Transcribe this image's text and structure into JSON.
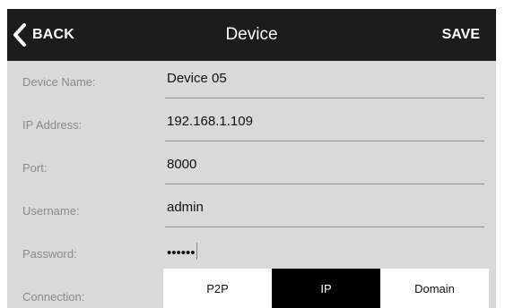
{
  "header": {
    "back_label": "BACK",
    "title": "Device",
    "save_label": "SAVE"
  },
  "form": {
    "fields": [
      {
        "label": "Device Name:",
        "value": "Device 05"
      },
      {
        "label": "IP Address:",
        "value": "192.168.1.109"
      },
      {
        "label": "Port:",
        "value": "8000"
      },
      {
        "label": "Username:",
        "value": "admin"
      },
      {
        "label": "Password:",
        "value": "••••••"
      }
    ],
    "connection": {
      "label": "Connection:",
      "options": [
        "P2P",
        "IP",
        "Domain"
      ],
      "selected": "IP"
    }
  },
  "colors": {
    "header_bg": "#1c1c1c",
    "form_bg": "#d9d9d9",
    "accent": "#3fa9a0",
    "selected_segment": "#000000"
  }
}
